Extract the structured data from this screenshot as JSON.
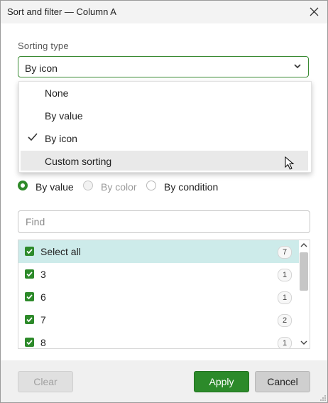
{
  "window": {
    "title": "Sort and filter — Column A"
  },
  "sorting": {
    "label": "Sorting type",
    "selected": "By icon",
    "options": [
      {
        "label": "None",
        "checked": false
      },
      {
        "label": "By value",
        "checked": false
      },
      {
        "label": "By icon",
        "checked": true
      },
      {
        "label": "Custom sorting",
        "checked": false,
        "hovered": true
      }
    ]
  },
  "filter_mode": [
    {
      "label": "By value",
      "state": "selected"
    },
    {
      "label": "By color",
      "state": "disabled"
    },
    {
      "label": "By condition",
      "state": "unselected"
    }
  ],
  "find": {
    "placeholder": "Find",
    "value": ""
  },
  "values_list": [
    {
      "label": "Select all",
      "count": "7",
      "checked": true
    },
    {
      "label": "3",
      "count": "1",
      "checked": true
    },
    {
      "label": "6",
      "count": "1",
      "checked": true
    },
    {
      "label": "7",
      "count": "2",
      "checked": true
    },
    {
      "label": "8",
      "count": "1",
      "checked": true
    }
  ],
  "footer": {
    "clear_label": "Clear",
    "apply_label": "Apply",
    "cancel_label": "Cancel"
  },
  "colors": {
    "accent": "#2c8a2a",
    "selected_row": "#cdebea",
    "hover": "#e9e9e9"
  },
  "icons": {
    "close": "close-icon",
    "dropdown": "chevron-down-icon",
    "check": "check-icon"
  }
}
